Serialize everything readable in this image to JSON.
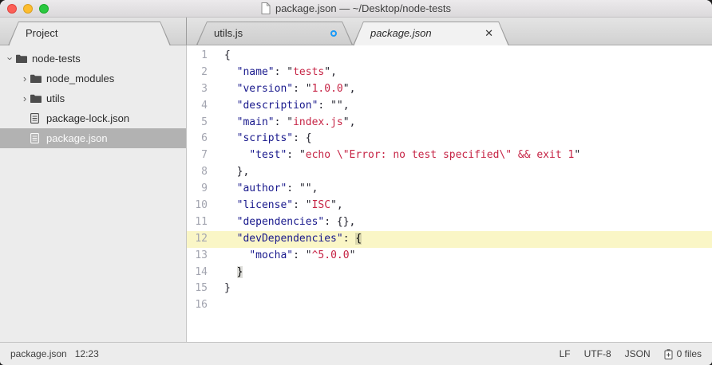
{
  "window": {
    "title": "package.json — ~/Desktop/node-tests"
  },
  "colors": {
    "current_line_highlight": "#faf6c6",
    "json_key": "#18188c",
    "json_string_value": "#c62445",
    "sidebar_selected_bg": "#b2b2b2",
    "modified_indicator_blue": "#1a9af7",
    "traffic_red": "#fc5f57",
    "traffic_yellow": "#fdbc2e",
    "traffic_green": "#2ac840"
  },
  "sidebar": {
    "header": "Project",
    "tree": [
      {
        "label": "node-tests",
        "type": "folder",
        "expanded": true,
        "level": 0,
        "selected": false
      },
      {
        "label": "node_modules",
        "type": "folder",
        "expanded": false,
        "level": 1,
        "selected": false
      },
      {
        "label": "utils",
        "type": "folder",
        "expanded": false,
        "level": 1,
        "selected": false
      },
      {
        "label": "package-lock.json",
        "type": "file",
        "level": 1,
        "selected": false
      },
      {
        "label": "package.json",
        "type": "file",
        "level": 1,
        "selected": true
      }
    ]
  },
  "tabs": [
    {
      "label": "utils.js",
      "active": false,
      "modified": true,
      "preview": false
    },
    {
      "label": "package.json",
      "active": true,
      "modified": false,
      "preview": true
    }
  ],
  "editor": {
    "current_line": 12,
    "lines": [
      [
        [
          "pun",
          "{"
        ]
      ],
      [
        [
          "pun",
          "  "
        ],
        [
          "key",
          "\"name\""
        ],
        [
          "pun",
          ": "
        ],
        [
          "q",
          "\""
        ],
        [
          "str",
          "tests"
        ],
        [
          "q",
          "\""
        ],
        [
          "pun",
          ","
        ]
      ],
      [
        [
          "pun",
          "  "
        ],
        [
          "key",
          "\"version\""
        ],
        [
          "pun",
          ": "
        ],
        [
          "q",
          "\""
        ],
        [
          "str",
          "1.0.0"
        ],
        [
          "q",
          "\""
        ],
        [
          "pun",
          ","
        ]
      ],
      [
        [
          "pun",
          "  "
        ],
        [
          "key",
          "\"description\""
        ],
        [
          "pun",
          ": "
        ],
        [
          "q",
          "\"\""
        ],
        [
          "pun",
          ","
        ]
      ],
      [
        [
          "pun",
          "  "
        ],
        [
          "key",
          "\"main\""
        ],
        [
          "pun",
          ": "
        ],
        [
          "q",
          "\""
        ],
        [
          "str",
          "index.js"
        ],
        [
          "q",
          "\""
        ],
        [
          "pun",
          ","
        ]
      ],
      [
        [
          "pun",
          "  "
        ],
        [
          "key",
          "\"scripts\""
        ],
        [
          "pun",
          ": {"
        ]
      ],
      [
        [
          "pun",
          "    "
        ],
        [
          "key",
          "\"test\""
        ],
        [
          "pun",
          ": "
        ],
        [
          "q",
          "\""
        ],
        [
          "str",
          "echo \\\"Error: no test specified\\\" && exit 1"
        ],
        [
          "q",
          "\""
        ]
      ],
      [
        [
          "pun",
          "  },"
        ]
      ],
      [
        [
          "pun",
          "  "
        ],
        [
          "key",
          "\"author\""
        ],
        [
          "pun",
          ": "
        ],
        [
          "q",
          "\"\""
        ],
        [
          "pun",
          ","
        ]
      ],
      [
        [
          "pun",
          "  "
        ],
        [
          "key",
          "\"license\""
        ],
        [
          "pun",
          ": "
        ],
        [
          "q",
          "\""
        ],
        [
          "str",
          "ISC"
        ],
        [
          "q",
          "\""
        ],
        [
          "pun",
          ","
        ]
      ],
      [
        [
          "pun",
          "  "
        ],
        [
          "key",
          "\"dependencies\""
        ],
        [
          "pun",
          ": {},"
        ]
      ],
      [
        [
          "pun",
          "  "
        ],
        [
          "key",
          "\"devDependencies\""
        ],
        [
          "pun",
          ": "
        ],
        [
          "mark",
          "{"
        ]
      ],
      [
        [
          "pun",
          "    "
        ],
        [
          "key",
          "\"mocha\""
        ],
        [
          "pun",
          ": "
        ],
        [
          "q",
          "\""
        ],
        [
          "str",
          "^5.0.0"
        ],
        [
          "q",
          "\""
        ]
      ],
      [
        [
          "pun",
          "  "
        ],
        [
          "mark",
          "}"
        ]
      ],
      [
        [
          "pun",
          "}"
        ]
      ],
      []
    ]
  },
  "status_bar": {
    "file": "package.json",
    "cursor_position": "12:23",
    "line_ending": "LF",
    "encoding": "UTF-8",
    "syntax": "JSON",
    "files_count": "0 files"
  }
}
